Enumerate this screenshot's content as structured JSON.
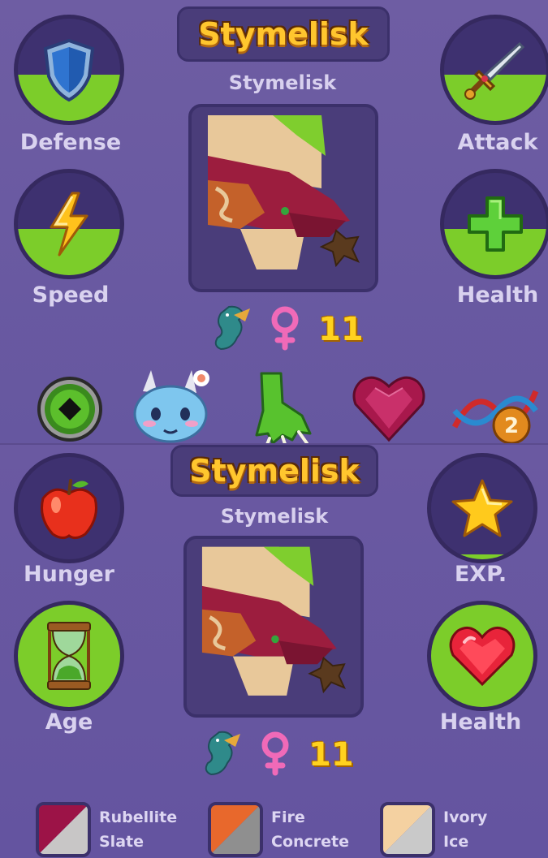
{
  "top_panel": {
    "title": "Stymelisk",
    "subname": "Stymelisk",
    "stats": {
      "defense": {
        "label": "Defense",
        "icon": "shield-icon",
        "fill": 0.45
      },
      "attack": {
        "label": "Attack",
        "icon": "sword-icon",
        "fill": 0.45
      },
      "speed": {
        "label": "Speed",
        "icon": "lightning-icon",
        "fill": 0.45
      },
      "health": {
        "label": "Health",
        "icon": "plus-icon",
        "fill": 0.45
      }
    },
    "level": "11",
    "gender_icon": "female-icon",
    "species_icon": "dragon-icon",
    "traits": [
      "eye-icon",
      "creature-face-icon",
      "claw-icon",
      "heart-gem-icon",
      "dna-icon"
    ],
    "dna_badge": "2"
  },
  "bottom_panel": {
    "title": "Stymelisk",
    "subname": "Stymelisk",
    "stats": {
      "hunger": {
        "label": "Hunger",
        "icon": "apple-icon",
        "fill": 0.0
      },
      "exp": {
        "label": "EXP.",
        "icon": "star-icon",
        "fill": 0.05
      },
      "age": {
        "label": "Age",
        "icon": "hourglass-icon",
        "fill": 1.0
      },
      "health": {
        "label": "Health",
        "icon": "heart-icon",
        "fill": 1.0
      }
    },
    "level": "11",
    "gender_icon": "female-icon",
    "species_icon": "dragon-icon"
  },
  "colors": {
    "swatches": [
      {
        "line1": "Rubellite",
        "line2": "Slate",
        "primary": "#9c1347",
        "secondary": "#c8c6c6"
      },
      {
        "line1": "Fire",
        "line2": "Concrete",
        "primary": "#e8682c",
        "secondary": "#8f8f8f"
      },
      {
        "line1": "Ivory",
        "line2": "Ice",
        "primary": "#f4d1a1",
        "secondary": "#c9c9c9"
      }
    ],
    "accent_green": "#7ccd2a",
    "title_gold": "#ffc62e"
  }
}
